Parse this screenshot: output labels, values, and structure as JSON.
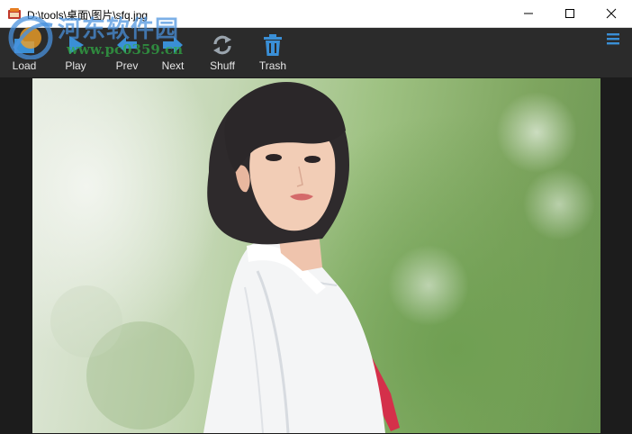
{
  "window": {
    "title": "D:\\tools\\桌面\\图片\\sfq.jpg"
  },
  "toolbar": {
    "buttons": [
      {
        "id": "load",
        "label": "Load",
        "icon": "folder-icon"
      },
      {
        "id": "play",
        "label": "Play",
        "icon": "play-icon"
      },
      {
        "id": "prev",
        "label": "Prev",
        "icon": "arrow-left-icon"
      },
      {
        "id": "next",
        "label": "Next",
        "icon": "arrow-right-icon"
      },
      {
        "id": "shuff",
        "label": "Shuff",
        "icon": "shuffle-icon"
      },
      {
        "id": "trash",
        "label": "Trash",
        "icon": "trash-icon"
      }
    ],
    "accent_color": "#3a8fd6"
  },
  "watermark": {
    "site_name": "河东软件园",
    "url": "www.pc0359.cn"
  },
  "viewer": {
    "image": "portrait photo of a short-haired girl in a white shirt with a red tie against a blurred green background"
  }
}
